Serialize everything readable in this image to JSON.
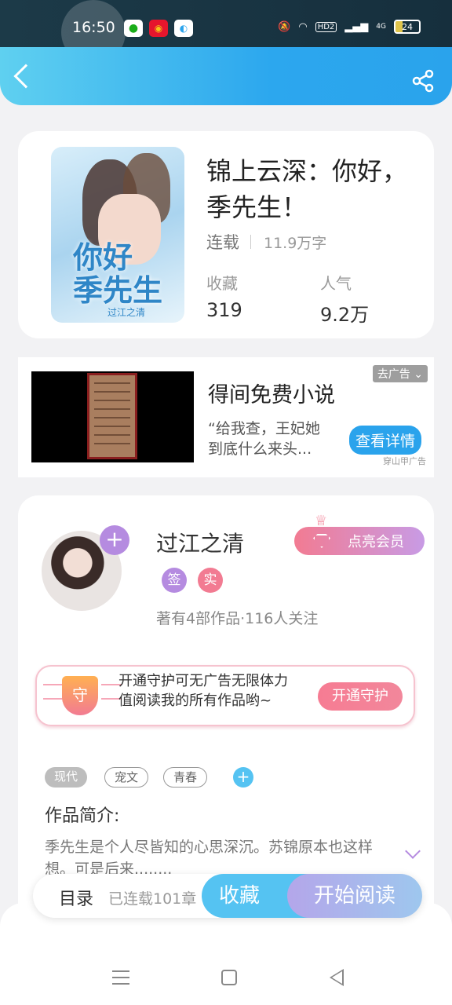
{
  "status_bar": {
    "time": "16:50",
    "network": "4G",
    "hd_label": "HD2",
    "battery": "24",
    "app_icons": [
      "wechat-icon",
      "weibo-icon",
      "app-icon"
    ]
  },
  "book": {
    "title": "锦上云深：你好，季先生！",
    "status": "连载",
    "word_count": "11.9万字",
    "favorites_label": "收藏",
    "favorites_value": "319",
    "popularity_label": "人气",
    "popularity_value": "9.2万",
    "cover_title_art": "你好\n季先生",
    "cover_author_art": "过江之清"
  },
  "ad": {
    "title": "得间免费小说",
    "description": "“给我查，王妃她到底什么来头...",
    "close_label": "去广告",
    "button_label": "查看详情",
    "source": "穿山甲广告"
  },
  "author": {
    "name": "过江之清",
    "badge_sign": "签",
    "badge_real": "实",
    "stats": "著有4部作品·116人关注",
    "follow_symbol": "+",
    "vip_label": "点亮会员"
  },
  "guard": {
    "shield_char": "守",
    "text": "开通守护可无广告无限体力值阅读我的所有作品哟~",
    "button_label": "开通守护"
  },
  "tags": [
    "现代",
    "宠文",
    "青春"
  ],
  "intro": {
    "label": "作品简介:",
    "text": "季先生是个人尽皆知的心思深沉。苏锦原本也这样想。可是后来........"
  },
  "bottom_bar": {
    "toc_label": "目录",
    "toc_sub": "已连载101章",
    "favorite_label": "收藏",
    "read_label": "开始阅读"
  },
  "colors": {
    "accent_blue": "#2aa3ec",
    "accent_pink": "#f27b92",
    "accent_purple": "#b58be0"
  }
}
